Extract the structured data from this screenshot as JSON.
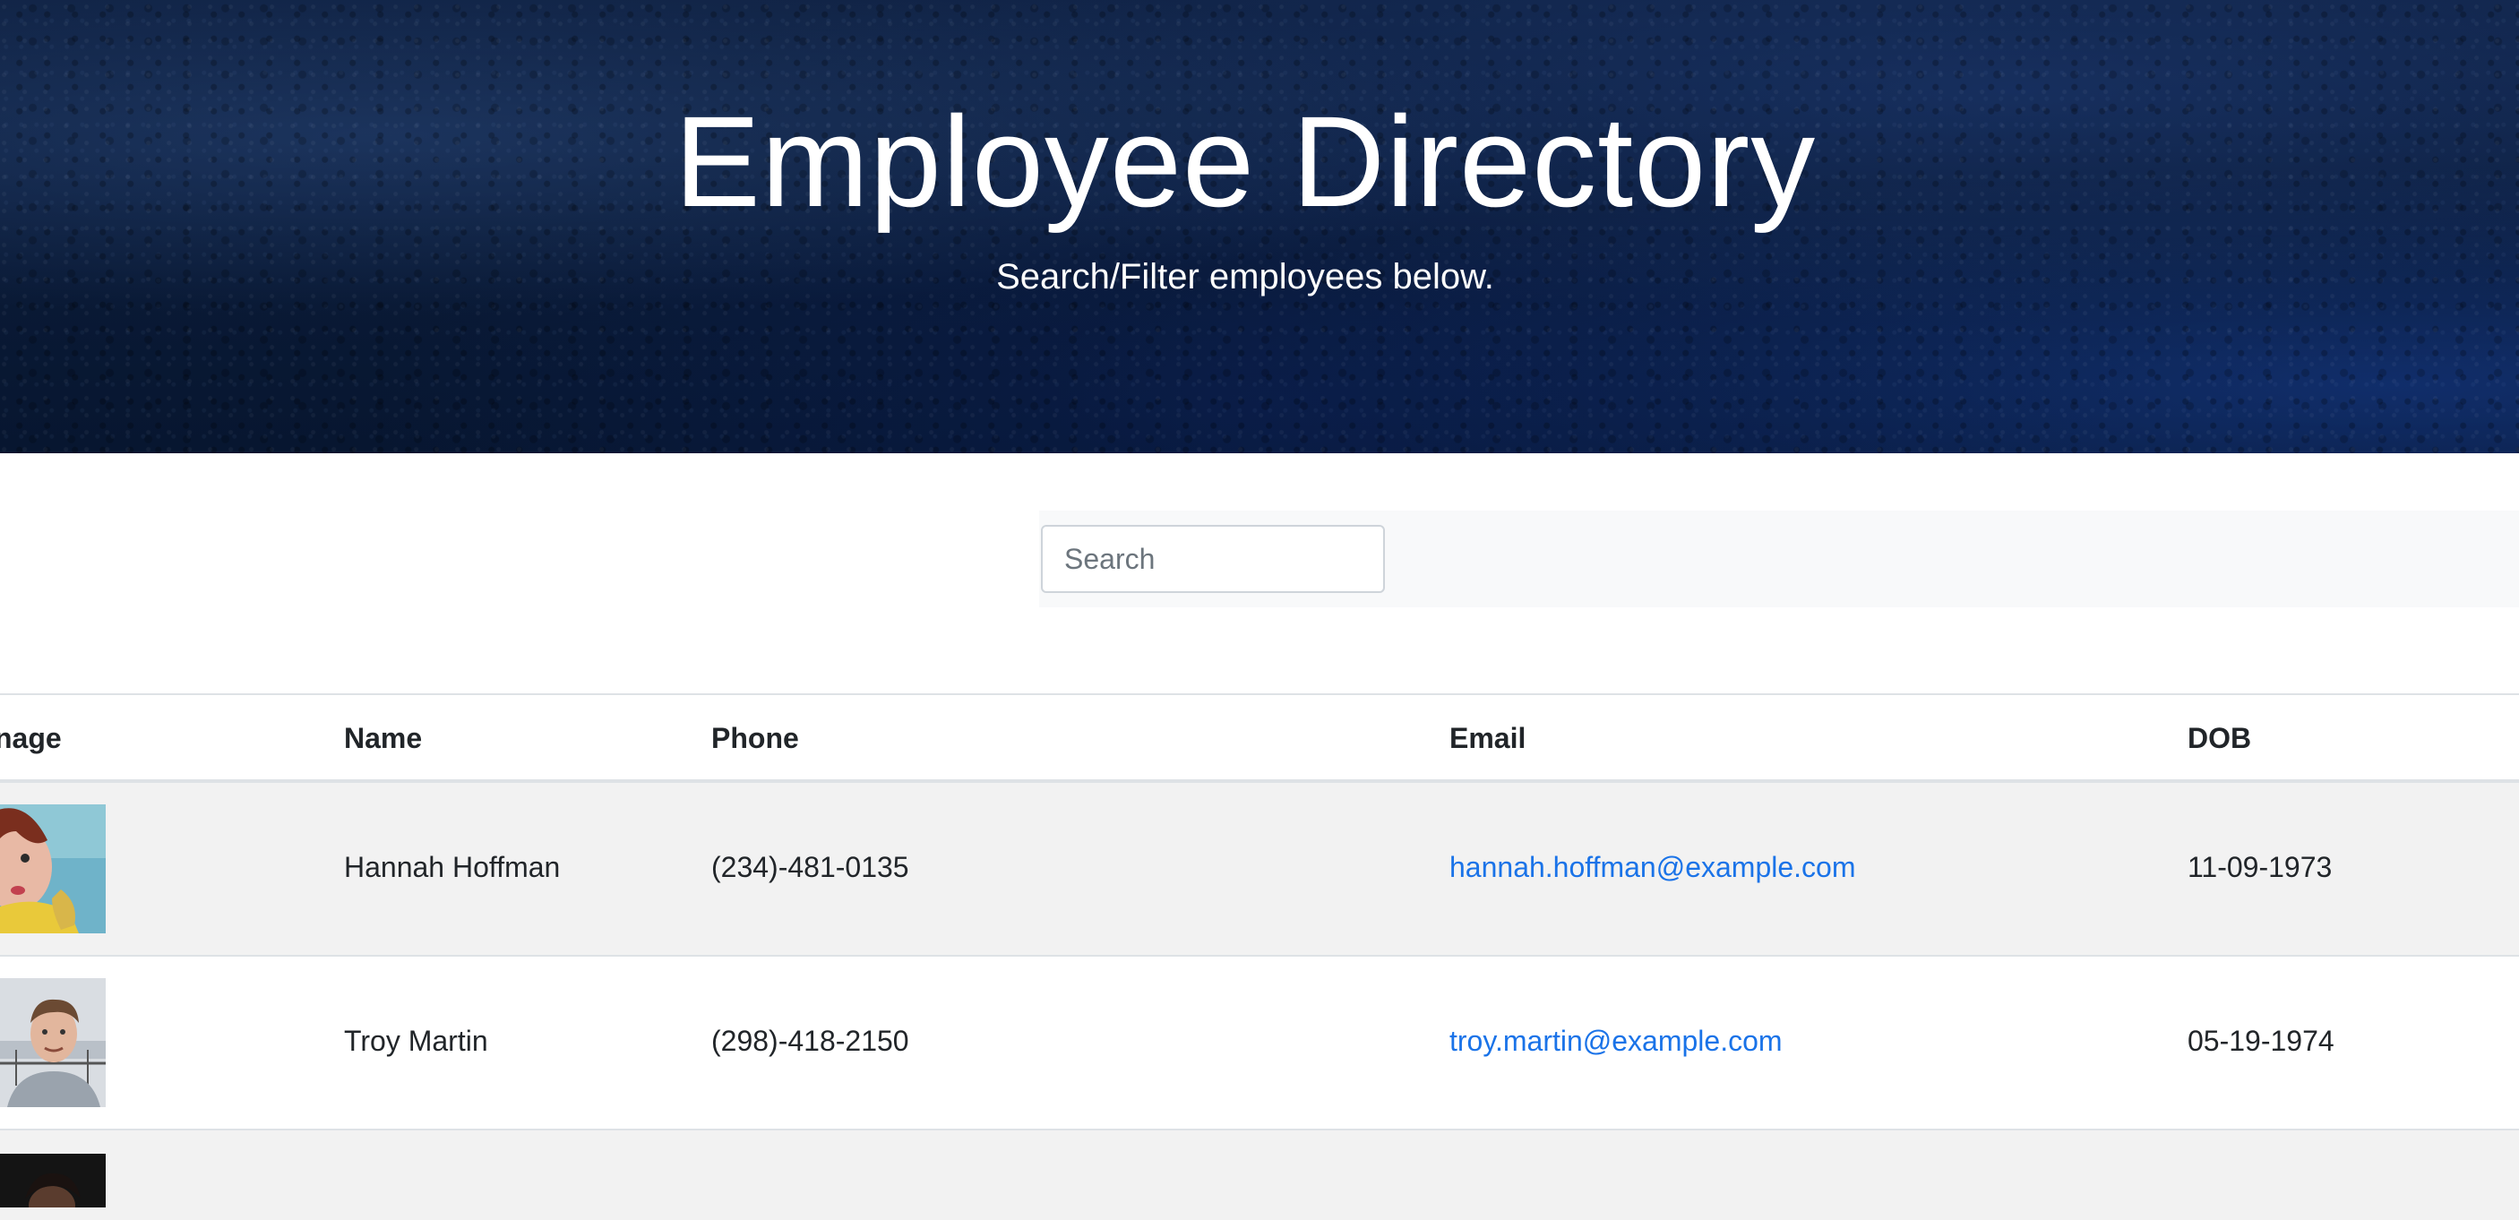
{
  "hero": {
    "title": "Employee Directory",
    "subtitle": "Search/Filter employees below."
  },
  "search": {
    "placeholder": "Search",
    "value": ""
  },
  "table": {
    "columns": [
      "Image",
      "Name",
      "Phone",
      "Email",
      "DOB"
    ],
    "header_image_visible": "nage",
    "rows": [
      {
        "name": "Hannah Hoffman",
        "phone": "(234)-481-0135",
        "email": "hannah.hoffman@example.com",
        "dob": "11-09-1973"
      },
      {
        "name": "Troy Martin",
        "phone": "(298)-418-2150",
        "email": "troy.martin@example.com",
        "dob": "05-19-1974"
      }
    ]
  },
  "colors": {
    "link": "#1a73e8",
    "hero_bg": "#0a1a36",
    "stripe": "#f2f2f2"
  }
}
